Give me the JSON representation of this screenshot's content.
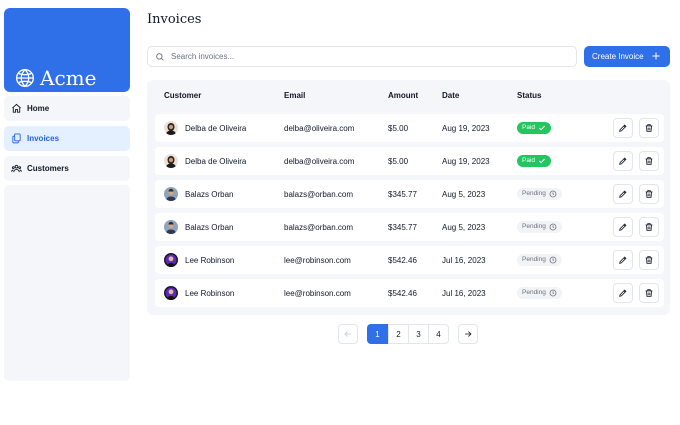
{
  "brand": {
    "name": "Acme",
    "color": "#2f6fe8",
    "icon": "globe-icon"
  },
  "sidebar": {
    "items": [
      {
        "label": "Home",
        "icon": "home-icon",
        "active": false
      },
      {
        "label": "Invoices",
        "icon": "document-duplicate-icon",
        "active": true
      },
      {
        "label": "Customers",
        "icon": "user-group-icon",
        "active": false
      }
    ]
  },
  "page": {
    "title": "Invoices"
  },
  "search": {
    "placeholder": "Search invoices..."
  },
  "toolbar": {
    "create_label": "Create Invoice",
    "create_icon": "plus-icon"
  },
  "table": {
    "columns": [
      "Customer",
      "Email",
      "Amount",
      "Date",
      "Status"
    ],
    "rows": [
      {
        "customer": "Delba de Oliveira",
        "email": "delba@oliveira.com",
        "amount": "$5.00",
        "date": "Aug 19, 2023",
        "status": "Paid"
      },
      {
        "customer": "Delba de Oliveira",
        "email": "delba@oliveira.com",
        "amount": "$5.00",
        "date": "Aug 19, 2023",
        "status": "Paid"
      },
      {
        "customer": "Balazs Orban",
        "email": "balazs@orban.com",
        "amount": "$345.77",
        "date": "Aug 5, 2023",
        "status": "Pending"
      },
      {
        "customer": "Balazs Orban",
        "email": "balazs@orban.com",
        "amount": "$345.77",
        "date": "Aug 5, 2023",
        "status": "Pending"
      },
      {
        "customer": "Lee Robinson",
        "email": "lee@robinson.com",
        "amount": "$542.46",
        "date": "Jul 16, 2023",
        "status": "Pending"
      },
      {
        "customer": "Lee Robinson",
        "email": "lee@robinson.com",
        "amount": "$542.46",
        "date": "Jul 16, 2023",
        "status": "Pending"
      }
    ]
  },
  "pagination": {
    "pages": [
      "1",
      "2",
      "3",
      "4"
    ],
    "current": "1"
  },
  "colors": {
    "paid": "#22c55e",
    "pending_bg": "#f1f3f5",
    "accent": "#2f6fe8"
  }
}
